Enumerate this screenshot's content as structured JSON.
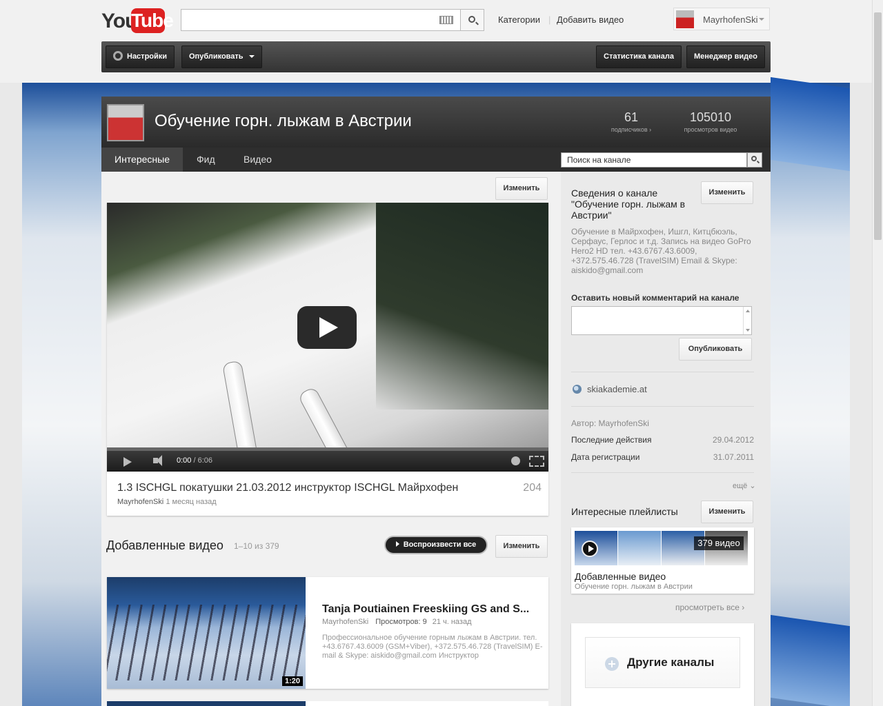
{
  "masthead": {
    "logo_you": "You",
    "logo_tube": "Tube",
    "search_value": "",
    "links": [
      "Категории",
      "Добавить видео"
    ],
    "username": "MayrhofenSki"
  },
  "toolbar": {
    "settings": "Настройки",
    "publish": "Опубликовать",
    "channel_stats": "Статистика канала",
    "video_manager": "Менеджер видео"
  },
  "channel": {
    "title": "Обучение горн. лыжам в Австрии",
    "subscribers": "61",
    "subscribers_label": "подписчиков ›",
    "views": "105010",
    "views_label": "просмотров видео",
    "tabs": [
      "Интересные",
      "Фид",
      "Видео"
    ],
    "search_placeholder": "Поиск на канале"
  },
  "featured": {
    "edit": "Изменить",
    "time_current": "0:00",
    "time_total": "/ 6:06",
    "title": "1.3 ISCHGL покатушки 21.03.2012 инструктор ISCHGL Майрхофен",
    "views": "204",
    "author": "MayrhofenSki",
    "ago": "1 месяц назад"
  },
  "added": {
    "title": "Добавленные видео",
    "count": "1–10 из 379",
    "play_all": "Воспроизвести все",
    "edit": "Изменить",
    "videos": [
      {
        "title": "Tanja Poutiainen Freeskiing GS and S...",
        "author": "MayrhofenSki",
        "views": "Просмотров: 9",
        "ago": "21 ч. назад",
        "description": "Профессиональное обучение горным лыжам в Австрии. тел. +43.6767.43.6009 (GSM+Viber), +372.575.46.728 (TravelSIM) E-mail & Skype: aiskido@gmail.com Инструктор",
        "duration": "1:20"
      }
    ]
  },
  "sidebar": {
    "about_title": "Сведения о канале \"Обучение горн. лыжам в Австрии\"",
    "about_edit": "Изменить",
    "about_desc": "Обучение в Майрхофен, Ишгл, Китцбюэль, Серфаус, Герлос и т.д. Запись на видео GoPro Hero2 HD тел. +43.6767.43.6009, +372.575.46.728 (TravelSIM) Email & Skype: aiskido@gmail.com",
    "comment_label": "Оставить новый комментарий на канале",
    "comment_value": "",
    "publish": "Опубликовать",
    "website": "skiakademie.at",
    "author": "Автор: MayrhofenSki",
    "last_activity_label": "Последние действия",
    "last_activity_value": "29.04.2012",
    "joined_label": "Дата регистрации",
    "joined_value": "31.07.2011",
    "more": "ещё ⌄",
    "playlists_title": "Интересные плейлисты",
    "playlists_edit": "Изменить",
    "playlist_count": "379 видео",
    "playlist_name": "Добавленные видео",
    "playlist_sub": "Обучение горн. лыжам в Австрии",
    "view_all": "просмотреть все ›",
    "other_channels": "Другие каналы"
  },
  "colors": {
    "brand_red": "#dd2222",
    "dark_bar": "#333333"
  }
}
